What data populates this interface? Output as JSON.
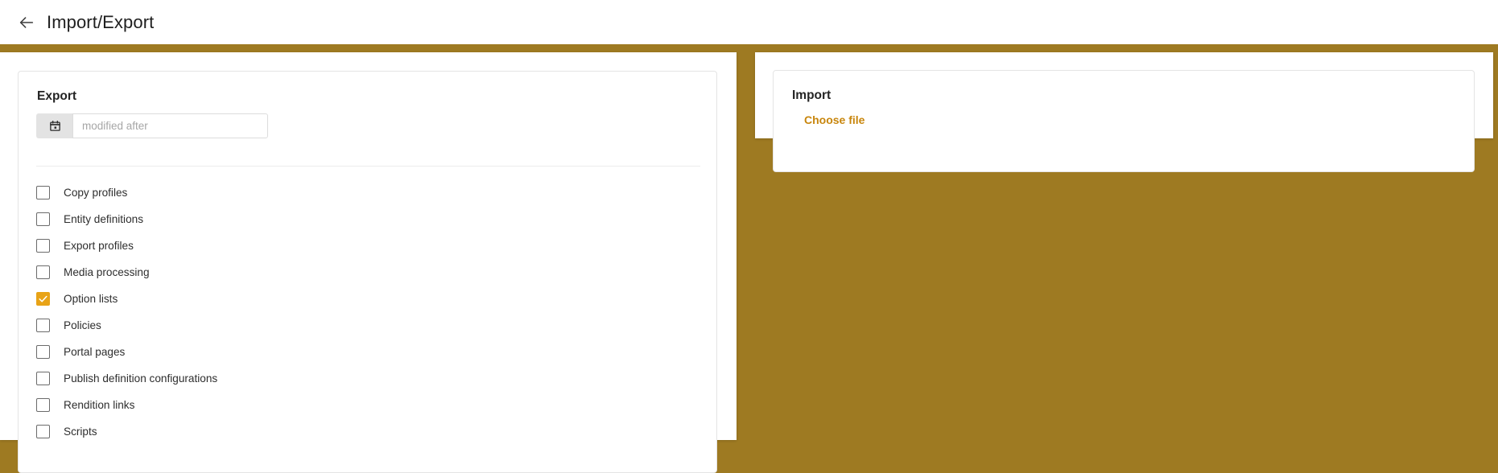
{
  "header": {
    "title": "Import/Export",
    "back_icon": "arrow-left-icon"
  },
  "theme": {
    "backdrop": "#9e7a22",
    "accent": "#e8a317",
    "link": "#c8860d",
    "panel": "#ffffff"
  },
  "export": {
    "heading": "Export",
    "date_filter": {
      "icon": "calendar-icon",
      "placeholder": "modified after",
      "value": ""
    },
    "options": [
      {
        "label": "Copy profiles",
        "checked": false
      },
      {
        "label": "Entity definitions",
        "checked": false
      },
      {
        "label": "Export profiles",
        "checked": false
      },
      {
        "label": "Media processing",
        "checked": false
      },
      {
        "label": "Option lists",
        "checked": true
      },
      {
        "label": "Policies",
        "checked": false
      },
      {
        "label": "Portal pages",
        "checked": false
      },
      {
        "label": "Publish definition configurations",
        "checked": false
      },
      {
        "label": "Rendition links",
        "checked": false
      },
      {
        "label": "Scripts",
        "checked": false
      }
    ]
  },
  "import": {
    "heading": "Import",
    "choose_file_label": "Choose file"
  }
}
